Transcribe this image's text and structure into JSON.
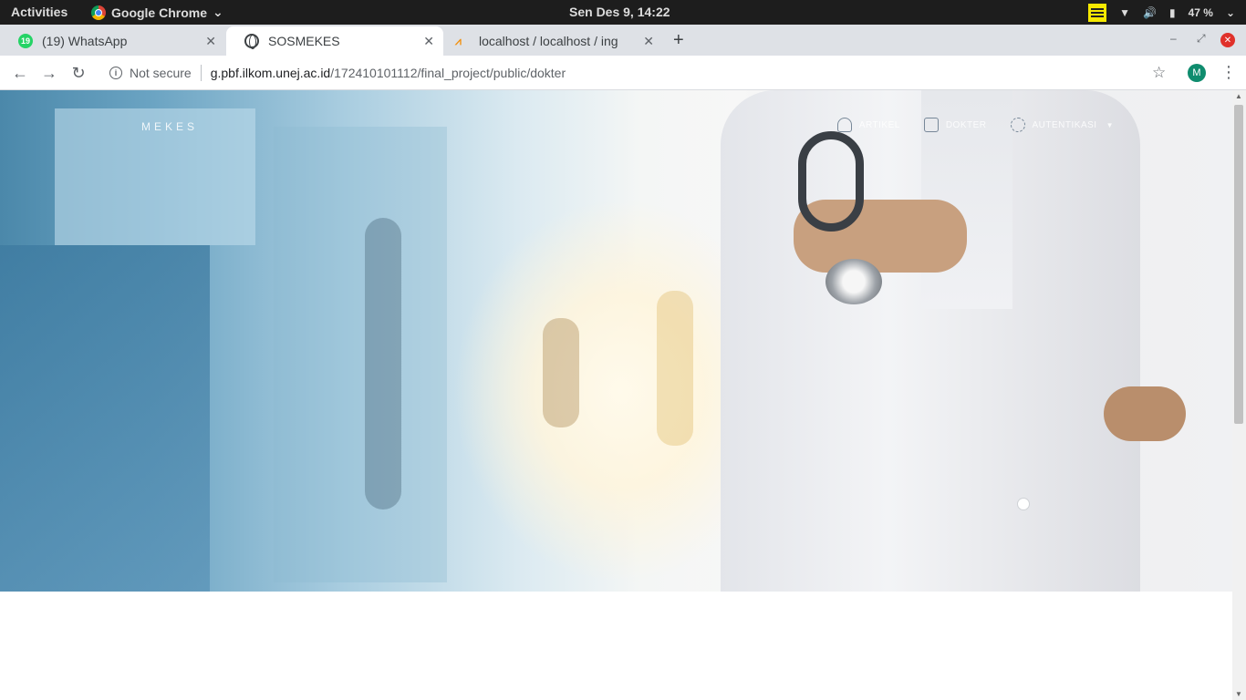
{
  "system_bar": {
    "activities": "Activities",
    "app_name": "Google Chrome",
    "clock": "Sen Des  9, 14:22",
    "battery": "47 %"
  },
  "tabs": [
    {
      "title": "(19) WhatsApp",
      "badge": "19",
      "icon": "whatsapp-icon"
    },
    {
      "title": "SOSMEKES",
      "icon": "globe-icon",
      "active": true
    },
    {
      "title": "localhost / localhost / ing",
      "icon": "phpmyadmin-icon"
    }
  ],
  "address_bar": {
    "security": "Not secure",
    "url_host": "g.pbf.ilkom.unej.ac.id",
    "url_path": "/172410101112/final_project/public/dokter",
    "avatar_letter": "M"
  },
  "page": {
    "brand": "MEKES",
    "nav": [
      {
        "label": "ARTIKEL",
        "icon": "cloud-icon"
      },
      {
        "label": "DOKTER",
        "icon": "id-card-icon"
      },
      {
        "label": "AUTENTIKASI",
        "icon": "gear-icon"
      }
    ]
  },
  "colors": {
    "tabstrip": "#dee1e6",
    "topbar": "#1d1d1d",
    "accent_green": "#0f8c6e"
  }
}
